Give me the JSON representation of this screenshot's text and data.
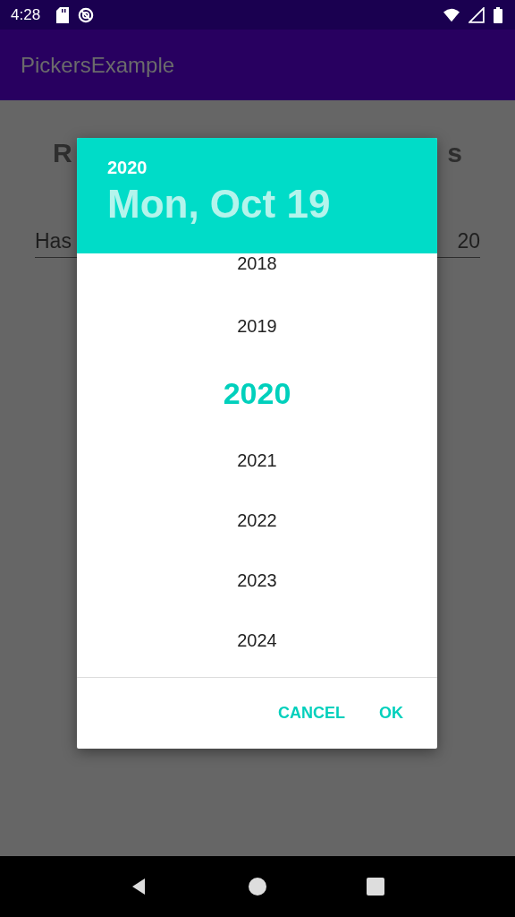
{
  "status_bar": {
    "time": "4:28"
  },
  "app_bar": {
    "title": "PickersExample"
  },
  "background": {
    "heading_start": "R",
    "heading_end": "s",
    "field_start": "Has",
    "field_end": "20"
  },
  "dialog": {
    "header_year": "2020",
    "header_date": "Mon, Oct 19",
    "years": [
      {
        "label": "2018",
        "selected": false
      },
      {
        "label": "2019",
        "selected": false
      },
      {
        "label": "2020",
        "selected": true
      },
      {
        "label": "2021",
        "selected": false
      },
      {
        "label": "2022",
        "selected": false
      },
      {
        "label": "2023",
        "selected": false
      },
      {
        "label": "2024",
        "selected": false
      }
    ],
    "buttons": [
      "CANCEL",
      "OK"
    ]
  }
}
